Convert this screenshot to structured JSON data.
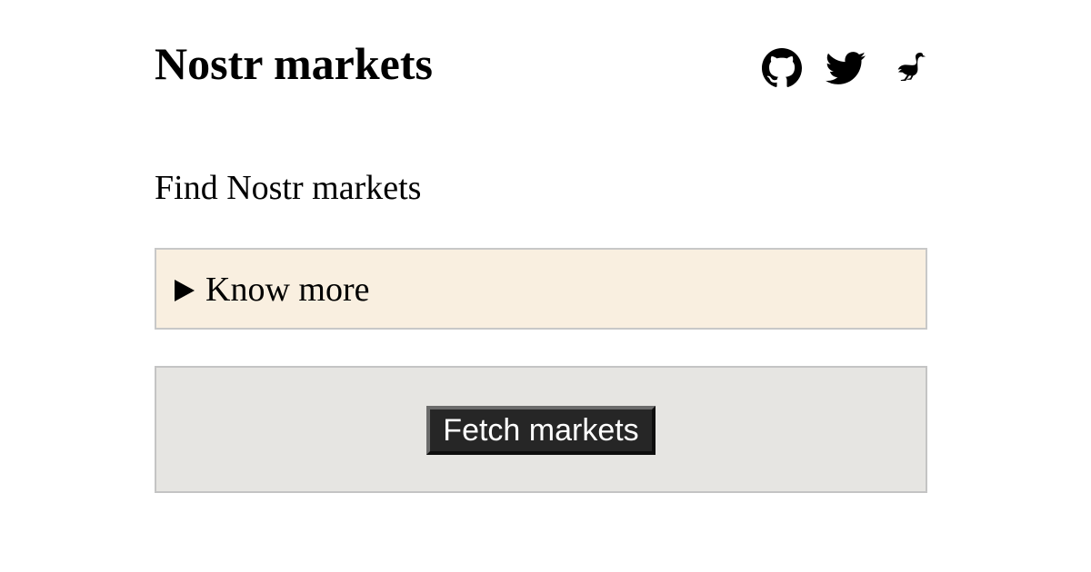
{
  "header": {
    "title": "Nostr markets",
    "social_links": [
      {
        "icon": "github-icon"
      },
      {
        "icon": "twitter-icon"
      },
      {
        "icon": "nostr-ostrich-icon"
      }
    ]
  },
  "intro": {
    "text": "Find Nostr markets"
  },
  "know_more": {
    "label": "Know more",
    "expanded": false,
    "background": "#f9efe0"
  },
  "fetch": {
    "button_label": "Fetch markets",
    "panel_background": "#e6e5e2",
    "button_background": "#262626"
  }
}
